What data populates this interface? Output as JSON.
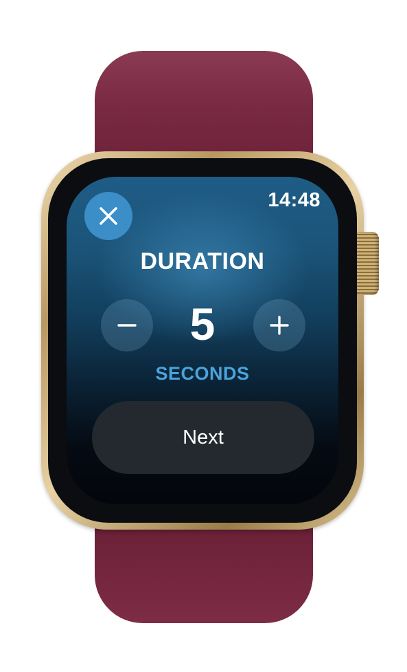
{
  "status_bar": {
    "time": "14:48"
  },
  "header": {
    "close_icon": "close-icon"
  },
  "duration": {
    "title": "DURATION",
    "value": "5",
    "unit": "SECONDS",
    "decrement_icon": "minus-icon",
    "increment_icon": "plus-icon"
  },
  "actions": {
    "next_label": "Next"
  },
  "colors": {
    "band": "#7a2a43",
    "case_gold": "#c9ad78",
    "close_button": "#3b8ec8",
    "unit_text": "#4aa3dc",
    "next_button": "#23292f"
  }
}
